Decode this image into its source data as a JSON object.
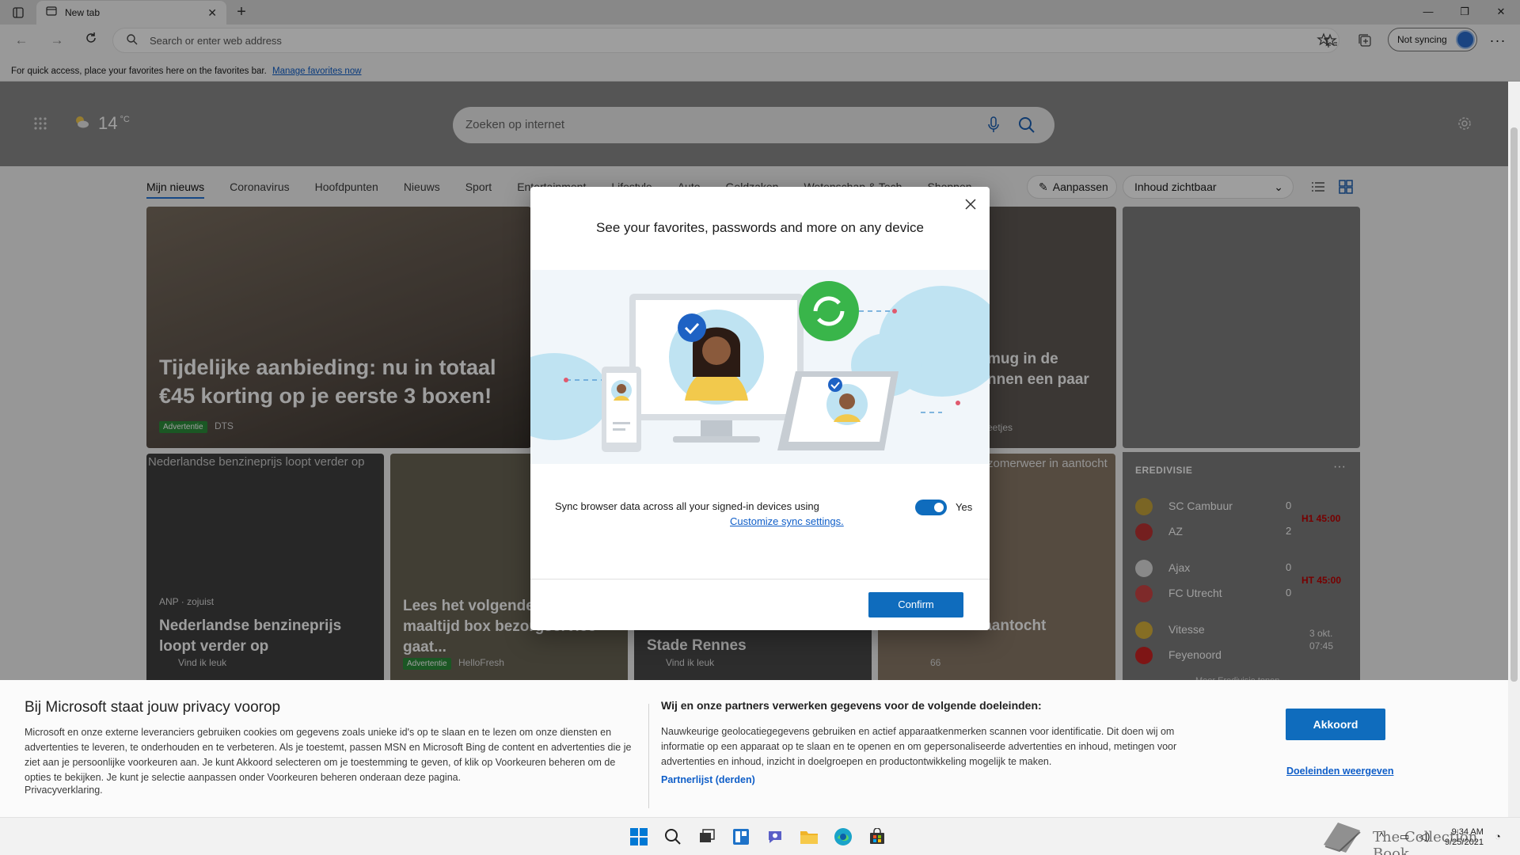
{
  "browser": {
    "tab_title": "New tab",
    "address_placeholder": "Search or enter web address",
    "sync_button": "Not syncing",
    "favbar_text": "For quick access, place your favorites here on the favorites bar.",
    "favbar_link": "Manage favorites now"
  },
  "page": {
    "weather_temp": "14",
    "weather_unit": "°C",
    "search_placeholder": "Zoeken op internet",
    "nav_tabs": [
      "Mijn nieuws",
      "Coronavirus",
      "Hoofdpunten",
      "Nieuws",
      "Sport",
      "Entertainment",
      "Lifestyle",
      "Auto",
      "Geldzaken",
      "Wetenschap & Tech",
      "Shoppen"
    ],
    "customize": "Aanpassen",
    "visibility": "Inhoud zichtbaar",
    "cards": {
      "main_headline": "Tijdelijke aanbieding: nu in totaal €45 korting op je eerste 3 boxen!",
      "main_badge": "Advertentie",
      "main_source": "DTS",
      "right_headline": "mug in de\nnnen een paar",
      "right_meta": "eetjes",
      "c1_alt": "Nederlandse benzineprijs loopt verder op",
      "c1_source": "ANP · zojuist",
      "c1_headline": "Nederlandse benzineprijs loopt verder op",
      "c1_like": "Vind ik leuk",
      "c2_headline": "Lees het volgende een maaltijd box bezorgservice gaat...",
      "c2_badge": "Advertentie",
      "c2_source": "HelloFresh",
      "c3_headline": "Stade Rennes",
      "c3_like": "Vind ik leuk",
      "c4_top": "zomerweer in aantocht",
      "c4_headline": "omerweer in aantocht",
      "c4_count": "66"
    },
    "sports": {
      "title": "EREDIVISIE",
      "matches": [
        {
          "home": "SC Cambuur",
          "away": "AZ",
          "home_score": "0",
          "away_score": "2",
          "status": "H1 45:00"
        },
        {
          "home": "Ajax",
          "away": "FC Utrecht",
          "home_score": "0",
          "away_score": "0",
          "status": "HT 45:00"
        },
        {
          "home": "Vitesse",
          "away": "Feyenoord",
          "date": "3 okt.",
          "time": "07:45"
        }
      ],
      "more": "Meer Eredivisie tonen"
    }
  },
  "dialog": {
    "title": "See your favorites, passwords and more on any device",
    "sync_text": "Sync browser data across all your signed-in devices using",
    "customize_link": "Customize sync settings.",
    "toggle_label": "Yes",
    "confirm": "Confirm"
  },
  "privacy": {
    "title": "Bij Microsoft staat jouw privacy voorop",
    "body": "Microsoft en onze externe leveranciers gebruiken cookies om gegevens zoals unieke id's op te slaan en te lezen om onze diensten en advertenties te leveren, te onderhouden en te verbeteren. Als je toestemt, passen MSN en Microsoft Bing de content en advertenties die je ziet aan je persoonlijke voorkeuren aan. Je kunt Akkoord selecteren om je toestemming te geven, of klik op Voorkeuren beheren om de opties te bekijken. Je kunt je selectie aanpassen onder Voorkeuren beheren onderaan deze pagina.",
    "privacy_link": "Privacyverklaring.",
    "title2": "Wij en onze partners verwerken gegevens voor de volgende doeleinden:",
    "body2": "Nauwkeurige geolocatiegegevens gebruiken en actief apparaatkenmerken scannen voor identificatie. Dit doen wij om informatie op een apparaat op te slaan en te openen en om gepersonaliseerde advertenties en inhoud, metingen voor advertenties en inhoud, inzicht in doelgroepen en productontwikkeling mogelijk te maken.",
    "partners": "Partnerlijst (derden)",
    "accept": "Akkoord",
    "purposes": "Doeleinden weergeven"
  },
  "taskbar": {
    "time": "9:34 AM",
    "date": "9/25/2021",
    "watermark": "The Collection Book"
  },
  "colors": {
    "accent": "#0f6cbd",
    "link": "#0f5ec8",
    "live": "#c10000"
  }
}
